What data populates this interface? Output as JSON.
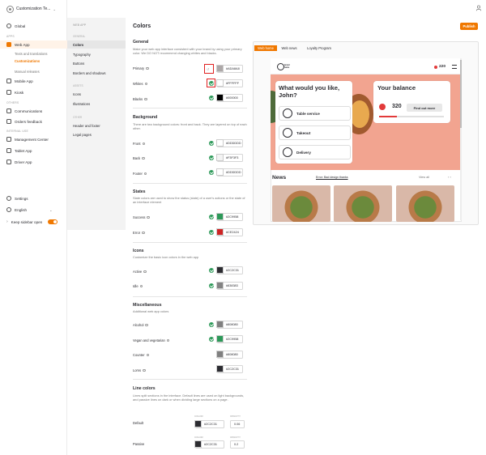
{
  "workspace": {
    "name": "Customization Te..."
  },
  "sidebar": {
    "global": "Global",
    "section_apps": "APPS",
    "web_app": "Web App",
    "web_app_sub": [
      "Texts and translations",
      "Customizations",
      "Manual releases"
    ],
    "mobile_app": "Mobile App",
    "kiosk": "Kiosk",
    "section_others": "OTHERS",
    "communications": "Communications",
    "orders_feedback": "Orders feedback",
    "section_internal": "INTERNAL USE",
    "management_center": "Management Center",
    "tablet_app": "Tablet App",
    "driver_app": "Driver App",
    "settings": "Settings",
    "language": "English",
    "keep_open": "Keep sidebar open"
  },
  "subpanel": {
    "title": "WEB APP",
    "section_general": "GENERAL",
    "general_items": [
      "Colors",
      "Typography",
      "Buttons",
      "Borders and shadows"
    ],
    "section_assets": "ASSETS",
    "asset_items": [
      "Icons",
      "Illustrations"
    ],
    "section_other": "OTHER",
    "other_items": [
      "Header and footer",
      "Legal pages"
    ]
  },
  "header": {
    "title": "Colors",
    "publish": "Publish"
  },
  "general": {
    "title": "General",
    "desc": "Make your web app interface consistent with your brand by using your primary color. We DO NOT recommend changing whites and blacks.",
    "rows": [
      {
        "label": "Primary",
        "hex": "#ADA8A8",
        "color": "#ada8a8"
      },
      {
        "label": "Whites",
        "hex": "#FFFFFF",
        "color": "#ffffff"
      },
      {
        "label": "Blacks",
        "hex": "#000000",
        "color": "#000000"
      }
    ]
  },
  "background": {
    "title": "Background",
    "desc": "There are two background colors: front and back. They are layered on top of each other.",
    "rows": [
      {
        "label": "Front",
        "hex": "#DDDDDD",
        "color": "#ffffff"
      },
      {
        "label": "Back",
        "hex": "#F3F3F3",
        "color": "#f3f3f3"
      },
      {
        "label": "Footer",
        "hex": "#DDDDDD",
        "color": "#ffffff"
      }
    ]
  },
  "states": {
    "title": "States",
    "desc": "State colors are used to show the status (state) of a user's actions or the state of an interface element",
    "rows": [
      {
        "label": "Success",
        "hex": "#2C9958",
        "color": "#2c9958"
      },
      {
        "label": "Error",
        "hex": "#CE2424",
        "color": "#ce2424"
      }
    ]
  },
  "icons": {
    "title": "Icons",
    "desc": "Customize the basic icon colors in the web app",
    "rows": [
      {
        "label": "Active",
        "hex": "#2C2C31",
        "color": "#2c2c31"
      },
      {
        "label": "Idle",
        "hex": "#838383",
        "color": "#838383"
      }
    ]
  },
  "misc": {
    "title": "Miscellaneous",
    "desc": "Additional web app colors",
    "rows": [
      {
        "label": "Alcohol",
        "hex": "#808080",
        "color": "#808080",
        "status": true
      },
      {
        "label": "Vegan and vegetarian",
        "hex": "#2C9958",
        "color": "#2c9958",
        "status": true
      },
      {
        "label": "Counter",
        "hex": "#808080",
        "color": "#808080",
        "status": false
      },
      {
        "label": "Loms",
        "hex": "#2C2C31",
        "color": "#2c2c31",
        "status": false
      }
    ]
  },
  "lines": {
    "title": "Line colors",
    "desc": "Lines split sections in the interface. Default lines are used on light backgrounds, and passive lines on dark or when dividing large sections on a page.",
    "color_label": "COLOR",
    "opacity_label": "OPACITY",
    "rows": [
      {
        "label": "Default",
        "hex": "#2C2C31",
        "color": "#2c2c31",
        "opacity": "0.06"
      },
      {
        "label": "Passive",
        "hex": "#2C2C31",
        "color": "#2c2c31",
        "opacity": "0.2"
      }
    ]
  },
  "preview": {
    "tabs": [
      "Web home",
      "Web news",
      "Loyalty Program"
    ],
    "logo_text": "brand\nname",
    "points": "220",
    "hero_title": "What would you like, John?",
    "options": [
      "Table service",
      "Takeout",
      "Delivery"
    ],
    "balance_title": "Your balance",
    "balance_value": "320",
    "find_out_more": "Find out more",
    "news_title": "News",
    "news_tab": "Error: Bad design thanks",
    "view_all": "View all",
    "arrows": "‹ ›"
  }
}
